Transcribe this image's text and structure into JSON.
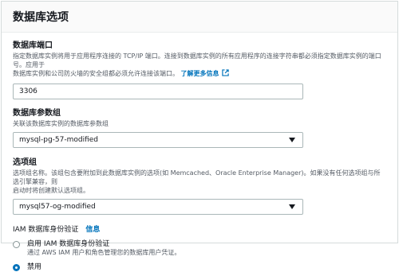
{
  "header": {
    "title": "数据库选项"
  },
  "port": {
    "label": "数据库端口",
    "desc_1": "指定数据库实例将用于应用程序连接的 TCP/IP 端口。连接到数据库实例的所有应用程序的连接字符串都必须指定数据库实例的端口号。应用于",
    "desc_2": "数据库实例和公司防火墙的安全组都必须允许连接该端口。",
    "learn_more": "了解更多信息",
    "value": "3306"
  },
  "param_group": {
    "label": "数据库参数组",
    "desc": "关联该数据库实例的数据库参数组",
    "selected": "mysql-pg-57-modified"
  },
  "option_group": {
    "label": "选项组",
    "desc_1": "选项组名称。该组包含要附加到此数据库实例的选项(如 Memcached、Oracle Enterprise Manager)。如果没有任何选项组与所选引擎兼容，则",
    "desc_2": "启动时将创建默认选项组。",
    "selected": "mysql57-og-modified"
  },
  "iam": {
    "label": "IAM 数据库身份验证",
    "info": "信息",
    "options": [
      {
        "label": "启用 IAM 数据库身份验证",
        "desc": "通过 AWS IAM 用户和角色管理您的数据库用户凭证。",
        "checked": false
      },
      {
        "label": "禁用",
        "desc": "",
        "checked": true
      }
    ]
  }
}
